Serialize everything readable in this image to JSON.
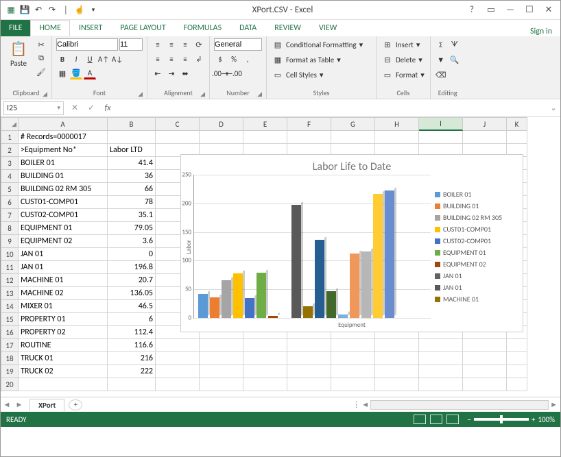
{
  "title": "XPort.CSV - Excel",
  "signin": "Sign in",
  "tabs": {
    "file": "FILE",
    "home": "HOME",
    "insert": "INSERT",
    "pagelayout": "PAGE LAYOUT",
    "formulas": "FORMULAS",
    "data": "DATA",
    "review": "REVIEW",
    "view": "VIEW"
  },
  "ribbon": {
    "clipboard": {
      "paste": "Paste",
      "label": "Clipboard"
    },
    "font": {
      "name": "Calibri",
      "size": "11",
      "label": "Font"
    },
    "alignment": {
      "label": "Alignment"
    },
    "number": {
      "format": "General",
      "label": "Number"
    },
    "styles": {
      "cond": "Conditional Formatting",
      "table": "Format as Table",
      "cells": "Cell Styles",
      "label": "Styles"
    },
    "cells": {
      "insert": "Insert",
      "delete": "Delete",
      "format": "Format",
      "label": "Cells"
    },
    "editing": {
      "label": "Editing"
    }
  },
  "namebox": "I25",
  "columns": [
    "A",
    "B",
    "C",
    "D",
    "E",
    "F",
    "G",
    "H",
    "I",
    "J",
    "K"
  ],
  "rows": [
    {
      "n": 1,
      "a": "# Records=0000017",
      "b": ""
    },
    {
      "n": 2,
      "a": ">Equipment No*",
      "b": "Labor LTD"
    },
    {
      "n": 3,
      "a": "BOILER 01",
      "b": "41.4"
    },
    {
      "n": 4,
      "a": "BUILDING 01",
      "b": "36"
    },
    {
      "n": 5,
      "a": "BUILDING 02 RM 305",
      "b": "66"
    },
    {
      "n": 6,
      "a": "CUST01-COMP01",
      "b": "78"
    },
    {
      "n": 7,
      "a": "CUST02-COMP01",
      "b": "35.1"
    },
    {
      "n": 8,
      "a": "EQUIPMENT 01",
      "b": "79.05"
    },
    {
      "n": 9,
      "a": "EQUIPMENT 02",
      "b": "3.6"
    },
    {
      "n": 10,
      "a": "JAN 01",
      "b": "0"
    },
    {
      "n": 11,
      "a": "JAN 01",
      "b": "196.8"
    },
    {
      "n": 12,
      "a": "MACHINE 01",
      "b": "20.7"
    },
    {
      "n": 13,
      "a": "MACHINE 02",
      "b": "136.05"
    },
    {
      "n": 14,
      "a": "MIXER 01",
      "b": "46.5"
    },
    {
      "n": 15,
      "a": "PROPERTY 01",
      "b": "6"
    },
    {
      "n": 16,
      "a": "PROPERTY 02",
      "b": "112.4"
    },
    {
      "n": 17,
      "a": "ROUTINE",
      "b": "116.6"
    },
    {
      "n": 18,
      "a": "TRUCK 01",
      "b": "216"
    },
    {
      "n": 19,
      "a": "TRUCK 02",
      "b": "222"
    },
    {
      "n": 20,
      "a": "",
      "b": ""
    }
  ],
  "sheet": "XPort",
  "status": {
    "ready": "READY",
    "zoom": "100%"
  },
  "chart_data": {
    "type": "bar",
    "title": "Labor Life to Date",
    "xlabel": "Equipment",
    "ylabel": "Labor",
    "ylim": [
      0,
      250
    ],
    "yticks": [
      0,
      50,
      100,
      150,
      200,
      250
    ],
    "series": [
      {
        "name": "BOILER 01",
        "value": 41.4,
        "color": "#5b9bd5"
      },
      {
        "name": "BUILDING 01",
        "value": 36,
        "color": "#ed7d31"
      },
      {
        "name": "BUILDING 02 RM 305",
        "value": 66,
        "color": "#a5a5a5"
      },
      {
        "name": "CUST01-COMP01",
        "value": 78,
        "color": "#ffc000"
      },
      {
        "name": "CUST02-COMP01",
        "value": 35.1,
        "color": "#4472c4"
      },
      {
        "name": "EQUIPMENT 01",
        "value": 79.05,
        "color": "#70ad47"
      },
      {
        "name": "EQUIPMENT 02",
        "value": 3.6,
        "color": "#9e480e"
      },
      {
        "name": "JAN 01",
        "value": 0,
        "color": "#636363"
      },
      {
        "name": "JAN 01",
        "value": 196.8,
        "color": "#595959"
      },
      {
        "name": "MACHINE 01",
        "value": 20.7,
        "color": "#947300"
      },
      {
        "name": "MACHINE 02",
        "value": 136.05,
        "color": "#255e91"
      },
      {
        "name": "MIXER 01",
        "value": 46.5,
        "color": "#43682b"
      },
      {
        "name": "PROPERTY 01",
        "value": 6,
        "color": "#7cafdd"
      },
      {
        "name": "PROPERTY 02",
        "value": 112.4,
        "color": "#f1975a"
      },
      {
        "name": "ROUTINE",
        "value": 116.6,
        "color": "#b7b7b7"
      },
      {
        "name": "TRUCK 01",
        "value": 216,
        "color": "#ffcd33"
      },
      {
        "name": "TRUCK 02",
        "value": 222,
        "color": "#698ed0"
      }
    ],
    "legend_visible": [
      "BOILER 01",
      "BUILDING 01",
      "BUILDING 02 RM 305",
      "CUST01-COMP01",
      "CUST02-COMP01",
      "EQUIPMENT 01",
      "EQUIPMENT 02",
      "JAN 01",
      "JAN 01",
      "MACHINE 01"
    ]
  }
}
